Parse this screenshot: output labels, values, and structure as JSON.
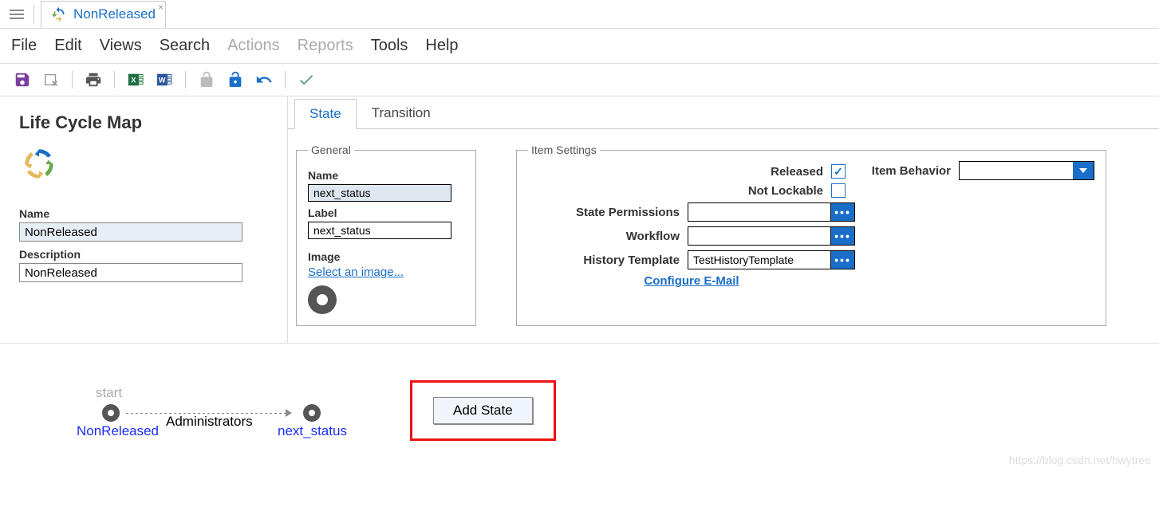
{
  "tab": {
    "title": "NonReleased"
  },
  "menu": {
    "file": "File",
    "edit": "Edit",
    "views": "Views",
    "search": "Search",
    "actions": "Actions",
    "reports": "Reports",
    "tools": "Tools",
    "help": "Help"
  },
  "left": {
    "title": "Life Cycle Map",
    "name_label": "Name",
    "name_value": "NonReleased",
    "desc_label": "Description",
    "desc_value": "NonReleased"
  },
  "subtabs": {
    "state": "State",
    "transition": "Transition"
  },
  "general": {
    "legend": "General",
    "name_label": "Name",
    "name_value": "next_status",
    "label_label": "Label",
    "label_value": "next_status",
    "image_label": "Image",
    "image_link": "Select an image..."
  },
  "item_settings": {
    "legend": "Item Settings",
    "released": "Released",
    "not_lockable": "Not Lockable",
    "state_permissions": "State Permissions",
    "workflow": "Workflow",
    "history_template": "History Template",
    "history_template_value": "TestHistoryTemplate",
    "item_behavior": "Item Behavior",
    "configure_email": "Configure E-Mail"
  },
  "diagram": {
    "start": "start",
    "node1": "NonReleased",
    "link": "Administrators",
    "node2": "next_status",
    "add_state": "Add State"
  },
  "watermark": "https://blog.csdn.net/hwytree"
}
